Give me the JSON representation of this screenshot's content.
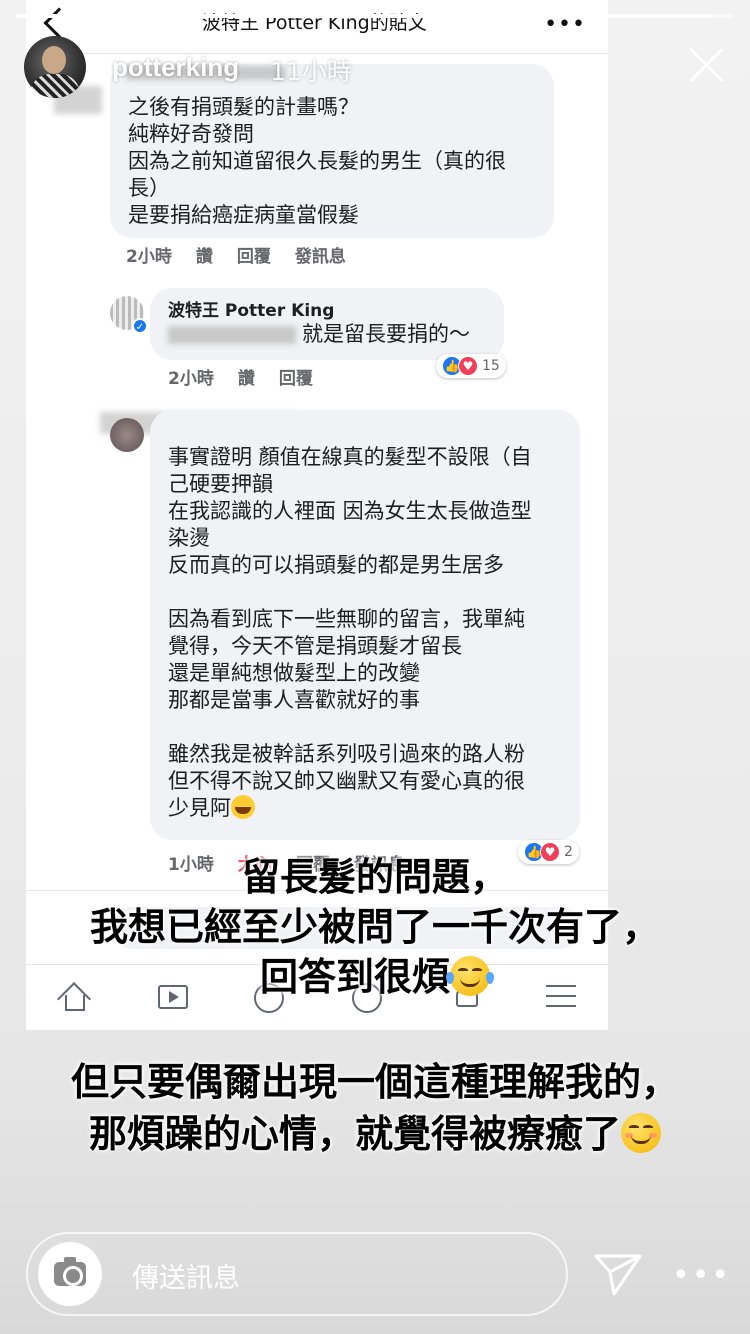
{
  "story": {
    "username": "potterking",
    "timestamp": "11小時",
    "progress": 0.97,
    "reply_placeholder": "傳送訊息"
  },
  "fb_screenshot": {
    "header_title": "波特王 Potter King的貼文",
    "comment1": {
      "lines": [
        "之後有捐頭髮的計畫嗎？",
        "純粹好奇發問",
        "因為之前知道留很久長髮的男生（真的很",
        "長）",
        "是要捐給癌症病童當假髮"
      ],
      "meta": [
        "2小時",
        "讚",
        "回覆",
        "發訊息"
      ]
    },
    "reply": {
      "author": "波特王 Potter King",
      "text": "就是留長要捐的～",
      "meta": [
        "2小時",
        "讚",
        "回覆"
      ],
      "reaction_count": "15"
    },
    "comment2": {
      "paragraph1": [
        "事實證明 顏值在線真的髮型不設限（自",
        "己硬要押韻",
        "在我認識的人裡面 因為女生太長做造型",
        "染燙",
        "反而真的可以捐頭髮的都是男生居多"
      ],
      "paragraph2": [
        "因為看到底下一些無聊的留言，我單純",
        "覺得，今天不管是捐頭髮才留長",
        "還是單純想做髮型上的改變",
        "那都是當事人喜歡就好的事"
      ],
      "paragraph3": [
        "雖然我是被幹話系列吸引過來的路人粉",
        "但不得不說又帥又幽默又有愛心真的很"
      ],
      "last_line": "少見阿",
      "meta": [
        "1小時",
        "大心",
        "回覆",
        "發訊息"
      ],
      "reaction_count": "2"
    }
  },
  "captions": {
    "caption1": "留長髮的問題，\n我想已經至少被問了一千次有了，\n回答到很煩",
    "caption2": "但只要偶爾出現一個這種理解我的，\n那煩躁的心情，就覺得被療癒了"
  },
  "icons": [
    "back-icon",
    "more-icon",
    "close-icon",
    "camera-icon",
    "send-icon",
    "more-dots-icon",
    "home-icon",
    "watch-icon",
    "profile-icon",
    "groups-icon",
    "notifications-icon",
    "menu-icon"
  ],
  "colors": {
    "fb_bubble": "#f0f2f5",
    "like_blue": "#1877f2",
    "love_red": "#f33e58"
  }
}
